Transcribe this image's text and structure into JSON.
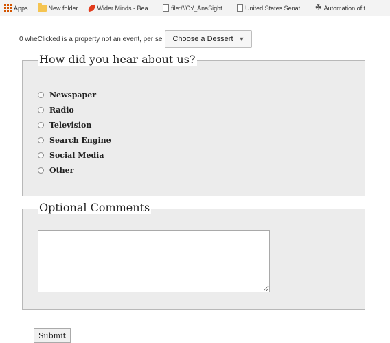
{
  "bookmarks": [
    {
      "label": "Apps",
      "icon": "apps-icon"
    },
    {
      "label": "New folder",
      "icon": "folder-icon"
    },
    {
      "label": "Wider Minds - Bea...",
      "icon": "leaf-icon"
    },
    {
      "label": "file:///C:/_AnaSight...",
      "icon": "page-icon"
    },
    {
      "label": "United States Senat...",
      "icon": "page-icon"
    },
    {
      "label": "Automation of t",
      "icon": "automation-icon"
    }
  ],
  "topline": {
    "text": "0 wheClicked is a property not an event, per se",
    "select_label": "Choose a Dessert"
  },
  "survey": {
    "legend": "How did you hear about us?",
    "options": [
      "Newspaper",
      "Radio",
      "Television",
      "Search Engine",
      "Social Media",
      "Other"
    ]
  },
  "comments": {
    "legend": "Optional Comments"
  },
  "submit_label": "Submit"
}
